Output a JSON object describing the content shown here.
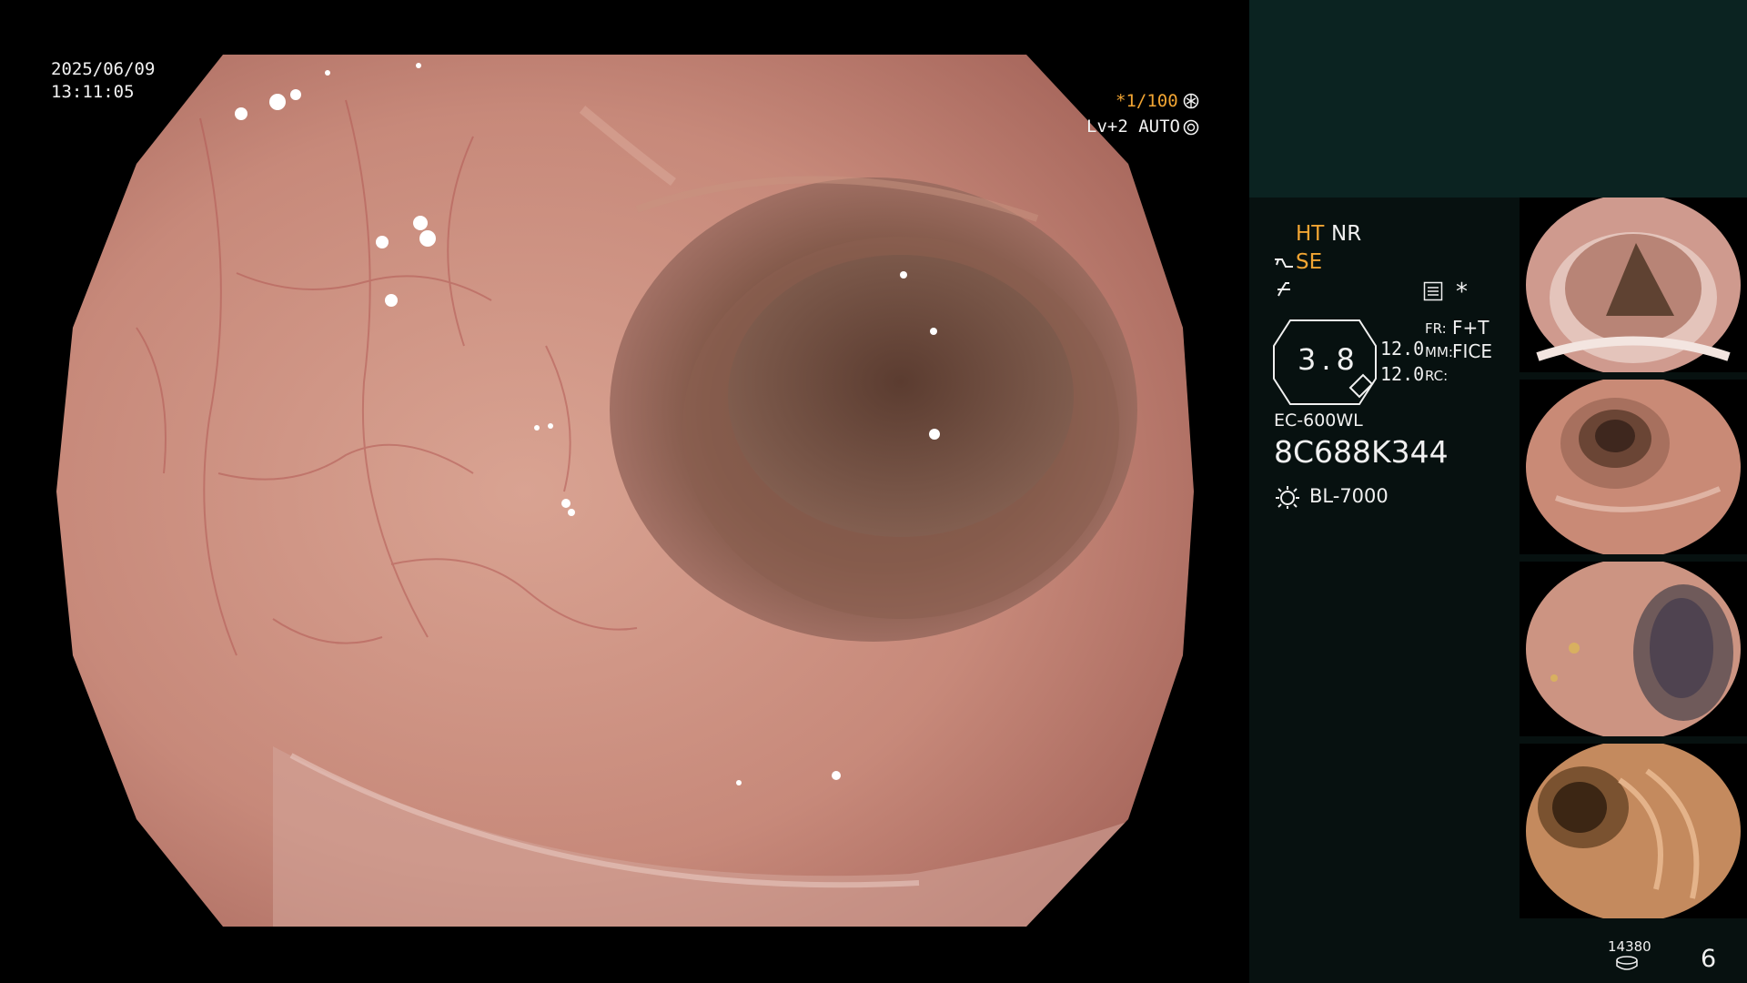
{
  "overlay": {
    "date": "2025/06/09",
    "time": "13:11:05",
    "shutter": "*1/100",
    "level": "Lv+2 AUTO"
  },
  "panel": {
    "modes": {
      "ht": "HT",
      "nr": "NR",
      "se": "SE"
    },
    "zoom_value": "3.8",
    "readout_1": "12.0",
    "readout_2": "12.0",
    "fr_label": "FR:",
    "fr_value": "F+T",
    "mm_label": "MM:",
    "mm_value": "FICE",
    "rc_label": "RC:",
    "scope_model": "EC-600WL",
    "serial": "8C688K344",
    "light_source": "BL-7000",
    "storage_count": "14380",
    "image_count": "6"
  },
  "icons": {
    "shutter": "aperture-icon",
    "level": "iris-icon",
    "structure_enhance": "scope-icon",
    "signal": "signal-icon",
    "settings": "menu-icon",
    "asterisk": "asterisk-icon",
    "light": "sun-icon",
    "storage": "disk-icon"
  },
  "thumbnails": [
    {
      "label": "thumbnail-1"
    },
    {
      "label": "thumbnail-2"
    },
    {
      "label": "thumbnail-3"
    },
    {
      "label": "thumbnail-4"
    }
  ],
  "colors": {
    "accent": "#f2a533",
    "panel_bg": "#071110",
    "panel_top_bg": "#0b2321",
    "mucosa": "#c98a7c"
  }
}
